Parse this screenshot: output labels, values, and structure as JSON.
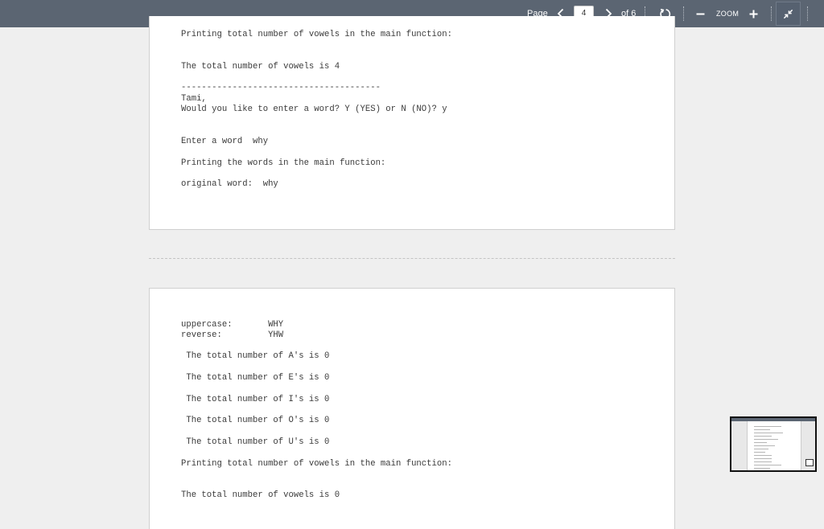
{
  "toolbar": {
    "page_label": "Page",
    "current_page": "4",
    "total_label": "of 6",
    "zoom_label": "ZOOM",
    "icons": {
      "prev": "chevron-left-icon",
      "next": "chevron-right-icon",
      "rotate": "rotate-icon",
      "zoom_out": "minus-icon",
      "zoom_in": "plus-icon",
      "fullscreen": "exit-fullscreen-icon"
    },
    "colors": {
      "background": "#5b6572",
      "text": "#ffffff"
    }
  },
  "document": {
    "page_top_lines": [
      "Printing total number of vowels in the main function:",
      "The total number of vowels is 4",
      "---------------------------------------",
      "Tami,",
      "Would you like to enter a word? Y (YES) or N (NO)? y",
      "Enter a word  why",
      "Printing the words in the main function:",
      "original word:  why"
    ],
    "page_bottom_lines": [
      "uppercase:       WHY",
      "reverse:         YHW",
      " The total number of A's is 0",
      " The total number of E's is 0",
      " The total number of I's is 0",
      " The total number of O's is 0",
      " The total number of U's is 0",
      "Printing total number of vowels in the main function:",
      "The total number of vowels is 0"
    ]
  },
  "navigator": {
    "icon": "page-thumbnail-icon"
  }
}
